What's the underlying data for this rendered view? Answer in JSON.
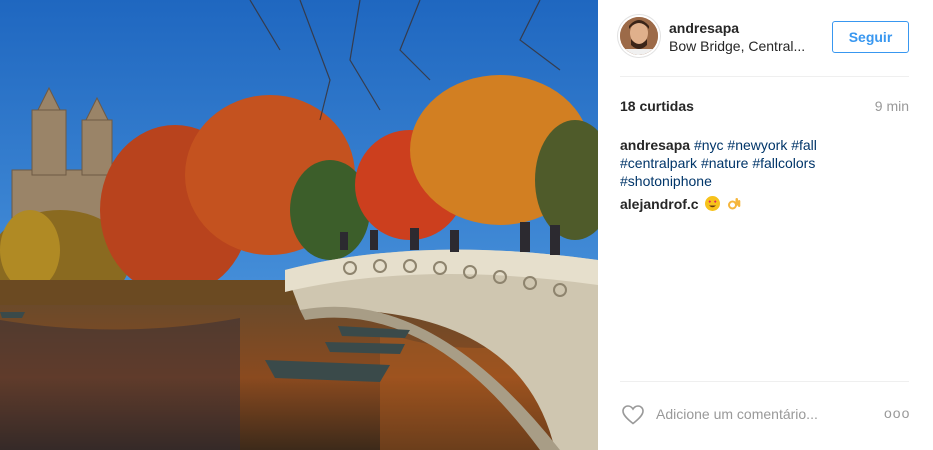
{
  "post": {
    "username": "andresapa",
    "location": "Bow Bridge, Central...",
    "follow_label": "Seguir",
    "likes": "18 curtidas",
    "time": "9 min",
    "caption_user": "andresapa",
    "hashtags": [
      "#nyc",
      "#newyork",
      "#fall",
      "#centralpark",
      "#nature",
      "#fallcolors",
      "#shotoniphone"
    ],
    "comment_user": "alejandrof.c",
    "comment_emojis": [
      "heart-eyes-emoji",
      "ok-hand-emoji"
    ],
    "add_comment_placeholder": "Adicione um comentário...",
    "more_label": "ooo"
  },
  "colors": {
    "accent": "#3897f0",
    "hashtag": "#003569",
    "muted": "#999999",
    "text": "#262626"
  }
}
